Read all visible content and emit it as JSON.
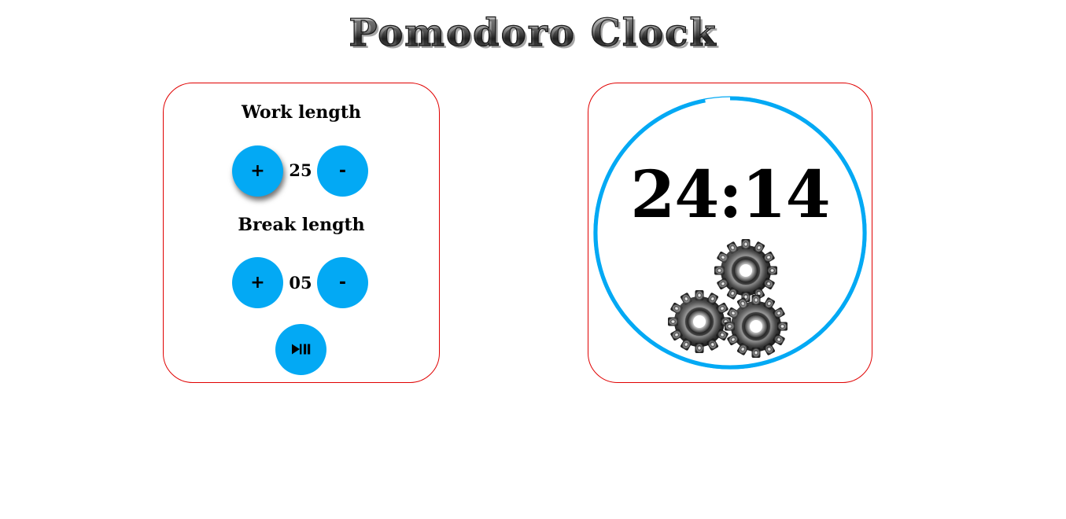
{
  "app": {
    "title": "Pomodoro Clock"
  },
  "settings": {
    "work": {
      "label": "Work length",
      "value": "25",
      "plus_label": "+",
      "minus_label": "-"
    },
    "break": {
      "label": "Break length",
      "value": "05",
      "plus_label": "+",
      "minus_label": "-"
    },
    "start_pause_icon": "play-pause-icon"
  },
  "timer": {
    "time": "24:14",
    "progress": 0.97,
    "ring_color": "#03a9f4",
    "status_icon": "gears-icon"
  },
  "colors": {
    "accent": "#03a9f4",
    "panel_border": "#e00000"
  }
}
